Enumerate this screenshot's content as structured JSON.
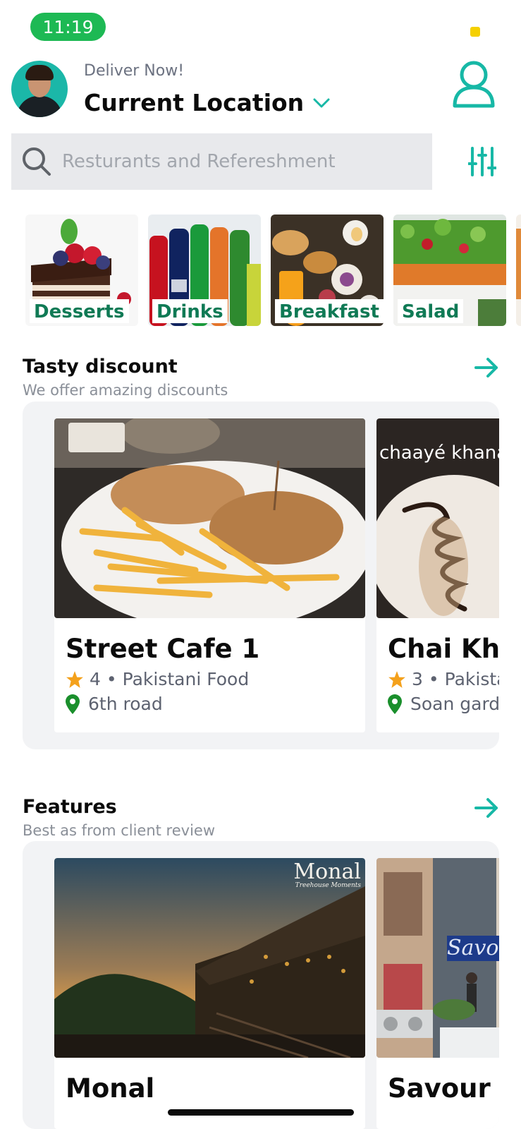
{
  "status": {
    "time": "11:19"
  },
  "header": {
    "deliver_label": "Deliver Now!",
    "location_title": "Current Location"
  },
  "search": {
    "placeholder": "Resturants and Refereshment"
  },
  "categories": [
    {
      "label": "Desserts"
    },
    {
      "label": "Drinks"
    },
    {
      "label": "Breakfast"
    },
    {
      "label": "Salad"
    }
  ],
  "discount_section": {
    "title": "Tasty discount",
    "subtitle": "We offer amazing discounts",
    "cards": [
      {
        "name": "Street Cafe 1",
        "rating": "4",
        "cuisine": "Pakistani Food",
        "location": "6th road"
      },
      {
        "name": "Chai Khana",
        "rating": "3",
        "cuisine": "Pakistani Food",
        "location": "Soan garden",
        "image_text": "chaayé khana"
      }
    ]
  },
  "features_section": {
    "title": "Features",
    "subtitle": "Best as from client review",
    "cards": [
      {
        "name": "Monal",
        "image_text": "Monal",
        "image_subtext": "Treehouse Moments"
      },
      {
        "name": "Savour foods",
        "image_text": "Savour"
      }
    ]
  },
  "colors": {
    "accent": "#17b8a6",
    "status_green": "#1db954",
    "category_label": "#0f7a55",
    "star": "#f4a11c",
    "pin": "#1a8f2c"
  }
}
